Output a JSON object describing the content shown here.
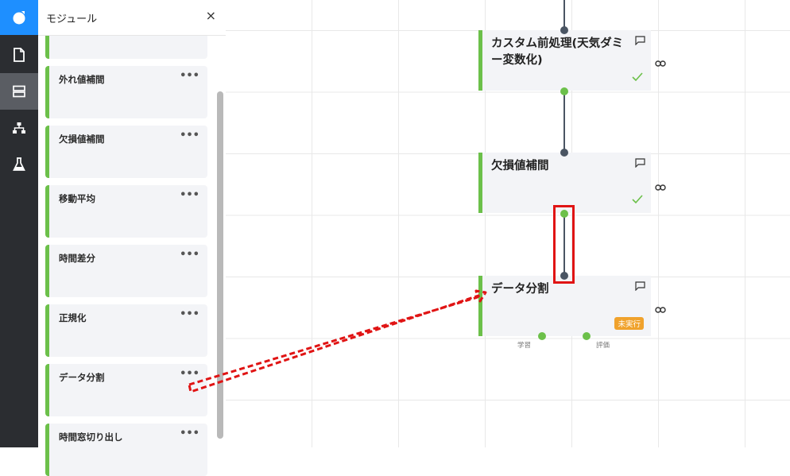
{
  "panel": {
    "title": "モジュール",
    "close": "×",
    "more": "•••",
    "modules": [
      {
        "label": ""
      },
      {
        "label": "外れ値補間"
      },
      {
        "label": "欠損値補間"
      },
      {
        "label": "移動平均"
      },
      {
        "label": "時間差分"
      },
      {
        "label": "正規化"
      },
      {
        "label": "データ分割"
      },
      {
        "label": "時間窓切り出し"
      }
    ]
  },
  "nodes": [
    {
      "title": "カスタム前処理(天気ダミー変数化)",
      "status": "done"
    },
    {
      "title": "欠損値補間",
      "status": "done"
    },
    {
      "title": "データ分割",
      "status": "未実行",
      "ports": [
        "学習",
        "評価"
      ]
    }
  ],
  "colors": {
    "accent_green": "#6cc04a",
    "brand_blue": "#1e8fff",
    "annotation_red": "#e01414",
    "badge_orange": "#f0a22c"
  }
}
